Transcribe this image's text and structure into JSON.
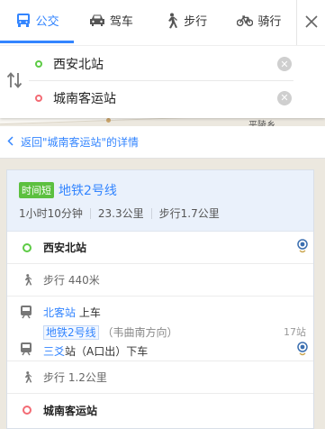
{
  "map": {
    "place_label": "平陵乡"
  },
  "modes": [
    {
      "label": "公交",
      "icon": "bus-icon",
      "active": true
    },
    {
      "label": "驾车",
      "icon": "car-icon",
      "active": false
    },
    {
      "label": "步行",
      "icon": "walk-icon",
      "active": false
    },
    {
      "label": "骑行",
      "icon": "bike-icon",
      "active": false
    }
  ],
  "origin": {
    "value": "西安北站"
  },
  "destination": {
    "value": "城南客运站"
  },
  "back": {
    "label": "返回\"城南客运站\"的详情"
  },
  "route": {
    "badge": "时间短",
    "name": "地铁2号线",
    "duration": "1小时10分钟",
    "distance": "23.3公里",
    "walk": "步行1.7公里"
  },
  "steps": {
    "start": "西安北站",
    "walk1": "步行 440米",
    "board_station": "北客站",
    "board_action": " 上车",
    "line": "地铁2号线",
    "direction": "（韦曲南方向）",
    "stops": "17站",
    "alight_station": "三爻",
    "alight_rest": "站（A口出）下车",
    "walk2": "步行 1.2公里",
    "end": "城南客运站"
  },
  "colors": {
    "accent": "#3385ff",
    "start": "#5dcb45",
    "end": "#f36b74",
    "badge": "#5cc03f"
  }
}
